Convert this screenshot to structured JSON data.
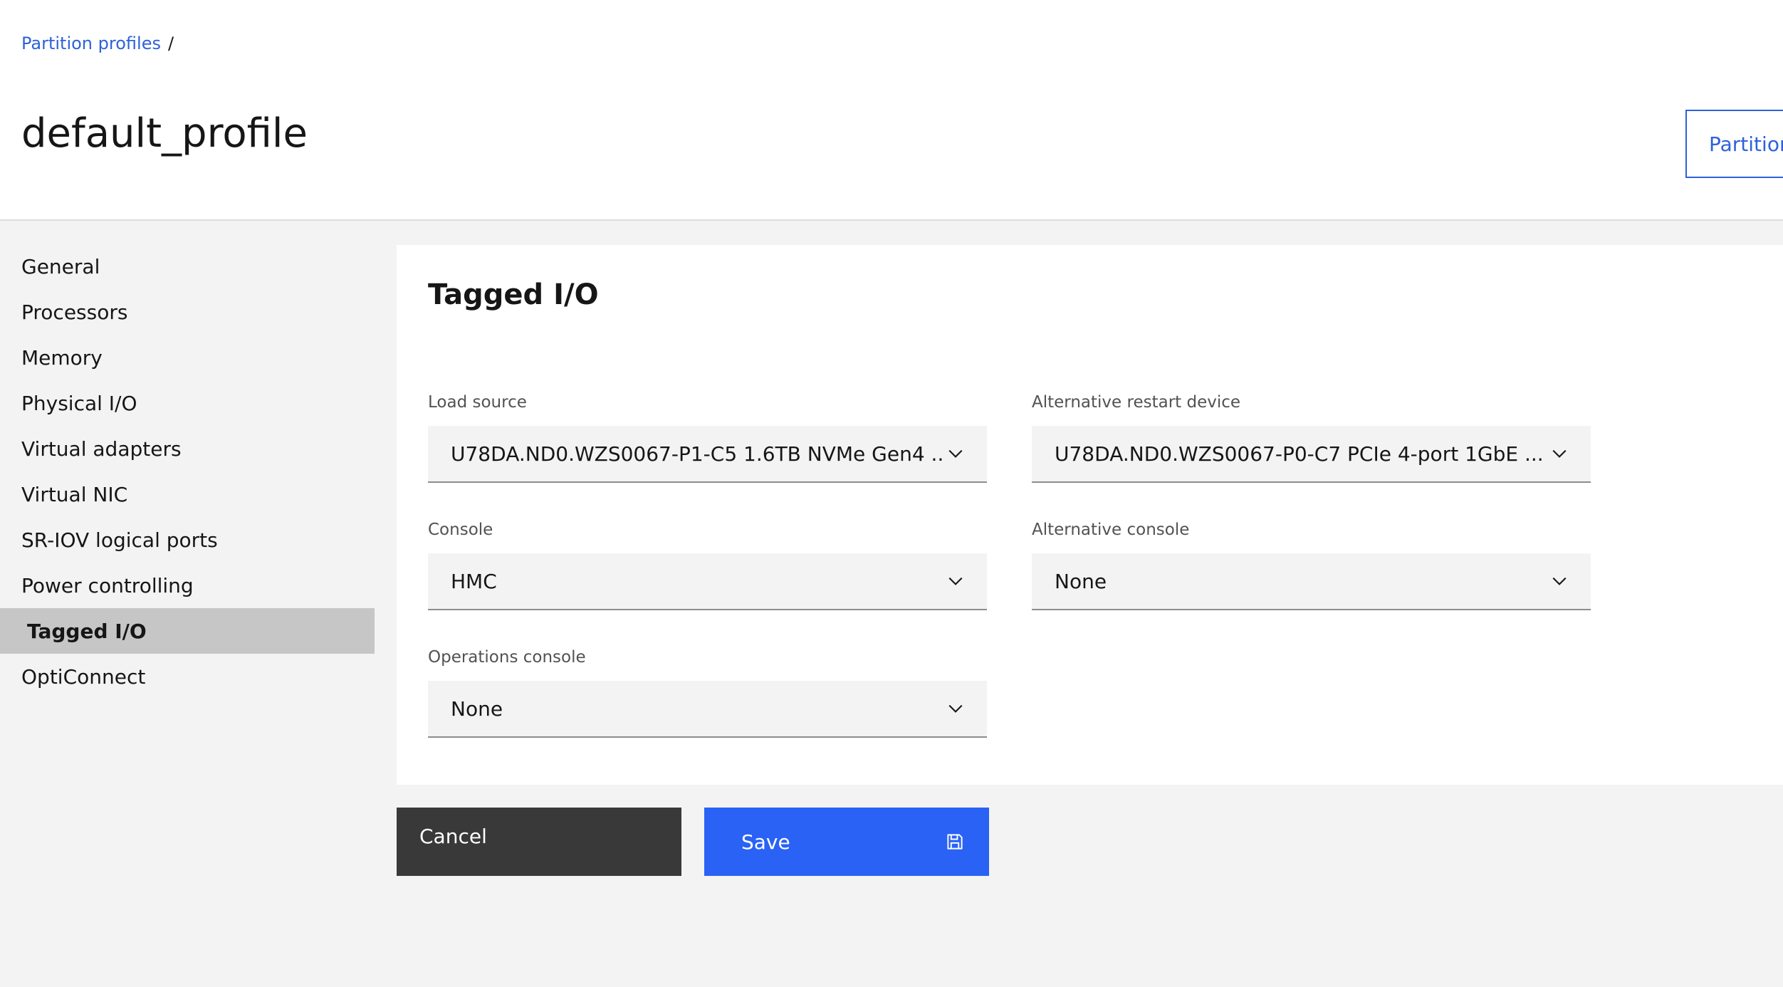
{
  "breadcrumb": {
    "link": "Partition profiles",
    "separator": "/"
  },
  "page_title": "default_profile",
  "header_button": "Partition",
  "sidebar": {
    "items": [
      {
        "label": "General",
        "active": false
      },
      {
        "label": "Processors",
        "active": false
      },
      {
        "label": "Memory",
        "active": false
      },
      {
        "label": "Physical I/O",
        "active": false
      },
      {
        "label": "Virtual adapters",
        "active": false
      },
      {
        "label": "Virtual NIC",
        "active": false
      },
      {
        "label": "SR-IOV logical ports",
        "active": false
      },
      {
        "label": "Power controlling",
        "active": false
      },
      {
        "label": "Tagged I/O",
        "active": true
      },
      {
        "label": "OptiConnect",
        "active": false
      }
    ]
  },
  "panel": {
    "title": "Tagged I/O",
    "fields": {
      "load_source": {
        "label": "Load source",
        "value": "U78DA.ND0.WZS0067-P1-C5 1.6TB NVMe Gen4 ..."
      },
      "alt_restart": {
        "label": "Alternative restart device",
        "value": "U78DA.ND0.WZS0067-P0-C7 PCIe 4-port 1GbE ..."
      },
      "console": {
        "label": "Console",
        "value": "HMC"
      },
      "alt_console": {
        "label": "Alternative console",
        "value": "None"
      },
      "ops_console": {
        "label": "Operations console",
        "value": "None"
      }
    }
  },
  "actions": {
    "cancel": "Cancel",
    "save": "Save"
  },
  "icons": {
    "dropdown": "chevron-down-icon",
    "save": "save-icon"
  },
  "colors": {
    "accent": "#2962f5",
    "link": "#2e62d9",
    "cancel_bg": "#393939",
    "active_nav": "#c6c6c6"
  }
}
